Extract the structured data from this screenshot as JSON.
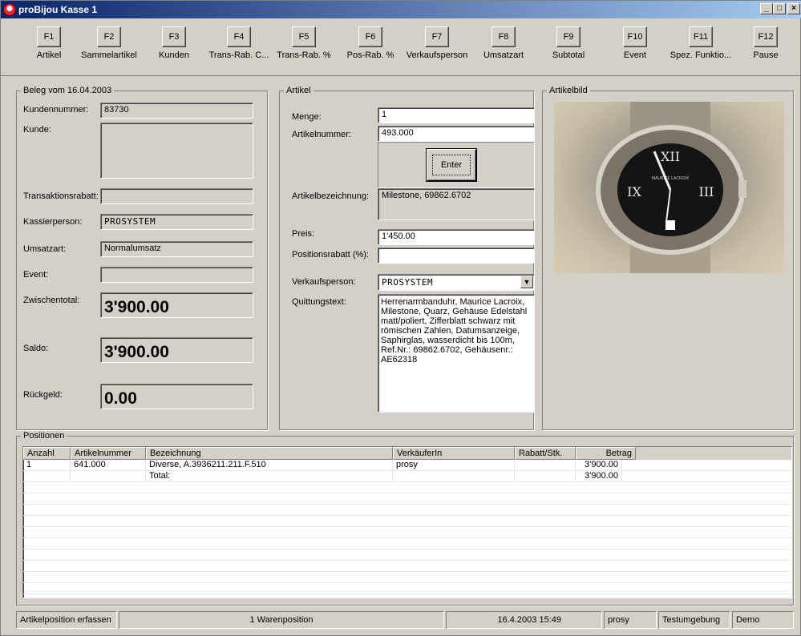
{
  "window": {
    "title": "proBijou Kasse 1",
    "controls": [
      "_",
      "□",
      "×"
    ]
  },
  "fkeys": [
    {
      "key": "F1",
      "label": "Artikel"
    },
    {
      "key": "F2",
      "label": "Sammelartikel"
    },
    {
      "key": "F3",
      "label": "Kunden"
    },
    {
      "key": "F4",
      "label": "Trans-Rab. C..."
    },
    {
      "key": "F5",
      "label": "Trans-Rab. %"
    },
    {
      "key": "F6",
      "label": "Pos-Rab. %"
    },
    {
      "key": "F7",
      "label": "Verkaufsperson"
    },
    {
      "key": "F8",
      "label": "Umsatzart"
    },
    {
      "key": "F9",
      "label": "Subtotal"
    },
    {
      "key": "F10",
      "label": "Event"
    },
    {
      "key": "F11",
      "label": "Spez. Funktio..."
    },
    {
      "key": "F12",
      "label": "Pause"
    }
  ],
  "beleg": {
    "legend": "Beleg vom 16.04.2003",
    "kundennummer_label": "Kundennummer:",
    "kundennummer": "83730",
    "kunde_label": "Kunde:",
    "kunde": "",
    "transaktionsrabatt_label": "Transaktionsrabatt:",
    "transaktionsrabatt": "",
    "kassierperson_label": "Kassierperson:",
    "kassierperson": "PROSYSTEM",
    "umsatzart_label": "Umsatzart:",
    "umsatzart": "Normalumsatz",
    "event_label": "Event:",
    "event": "",
    "zwischentotal_label": "Zwischentotal:",
    "zwischentotal": "3'900.00",
    "saldo_label": "Saldo:",
    "saldo": "3'900.00",
    "rueckgeld_label": "Rückgeld:",
    "rueckgeld": "0.00"
  },
  "artikel": {
    "legend": "Artikel",
    "menge_label": "Menge:",
    "menge": "1",
    "artikelnummer_label": "Artikelnummer:",
    "artikelnummer": "493.000",
    "enter_label": "Enter",
    "bezeichnung_label": "Artikelbezeichnung:",
    "bezeichnung": "Milestone, 69862.6702",
    "preis_label": "Preis:",
    "preis": "1'450.00",
    "positionsrabatt_label": "Positionsrabatt (%):",
    "positionsrabatt": "",
    "verkaufsperson_label": "Verkaufsperson:",
    "verkaufsperson": "PROSYSTEM",
    "quittungstext_label": "Quittungstext:",
    "quittungstext": "Herrenarmbanduhr, Maurice Lacroix,\nMilestone, Quarz, Gehäuse Edelstahl\nmatt/poliert, Zifferblatt schwarz mit\nrömischen Zahlen, Datumsanzeige,\nSaphirglas, wasserdicht bis 100m,\nRef.Nr.: 69862.6702, Gehäusenr.:\nAE62318"
  },
  "artikelbild": {
    "legend": "Artikelbild",
    "brand_text": "MAURICE LACROIX"
  },
  "positionen": {
    "legend": "Positionen",
    "columns": [
      "Anzahl",
      "Artikelnummer",
      "Bezeichnung",
      "VerkäuferIn",
      "Rabatt/Stk.",
      "Betrag"
    ],
    "rows": [
      [
        "1",
        "641.000",
        "Diverse, A.3936211.211.F.510",
        "prosy",
        "",
        "3'900.00"
      ],
      [
        "",
        "",
        "Total:",
        "",
        "",
        "3'900.00"
      ]
    ]
  },
  "status": {
    "mode": "Artikelposition erfassen",
    "count": "1 Warenposition",
    "datetime": "16.4.2003 15:49",
    "user": "prosy",
    "environment": "Testumgebung",
    "license": "Demo"
  }
}
